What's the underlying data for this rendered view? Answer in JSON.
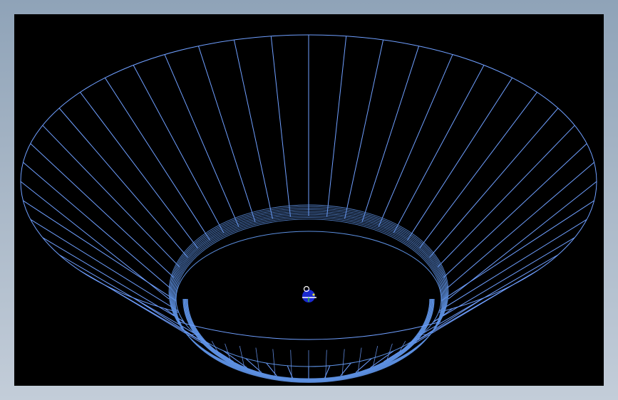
{
  "window": {
    "background_color": "#9fb0c2"
  },
  "viewport": {
    "view_mode": "wireframe",
    "background_color": "#000000",
    "wire_color": "#6f9fff",
    "rim_color": "#5c8fe0",
    "model": {
      "shape": "conical-bowl",
      "vertical_segments": 48
    },
    "origin_marker": {
      "icon": "coordinate-origin-icon",
      "colors": {
        "body": "#1a2ad0",
        "x_axis": "#ffffff",
        "y_axis": "#30c030",
        "z_axis": "#e0e040"
      }
    }
  }
}
